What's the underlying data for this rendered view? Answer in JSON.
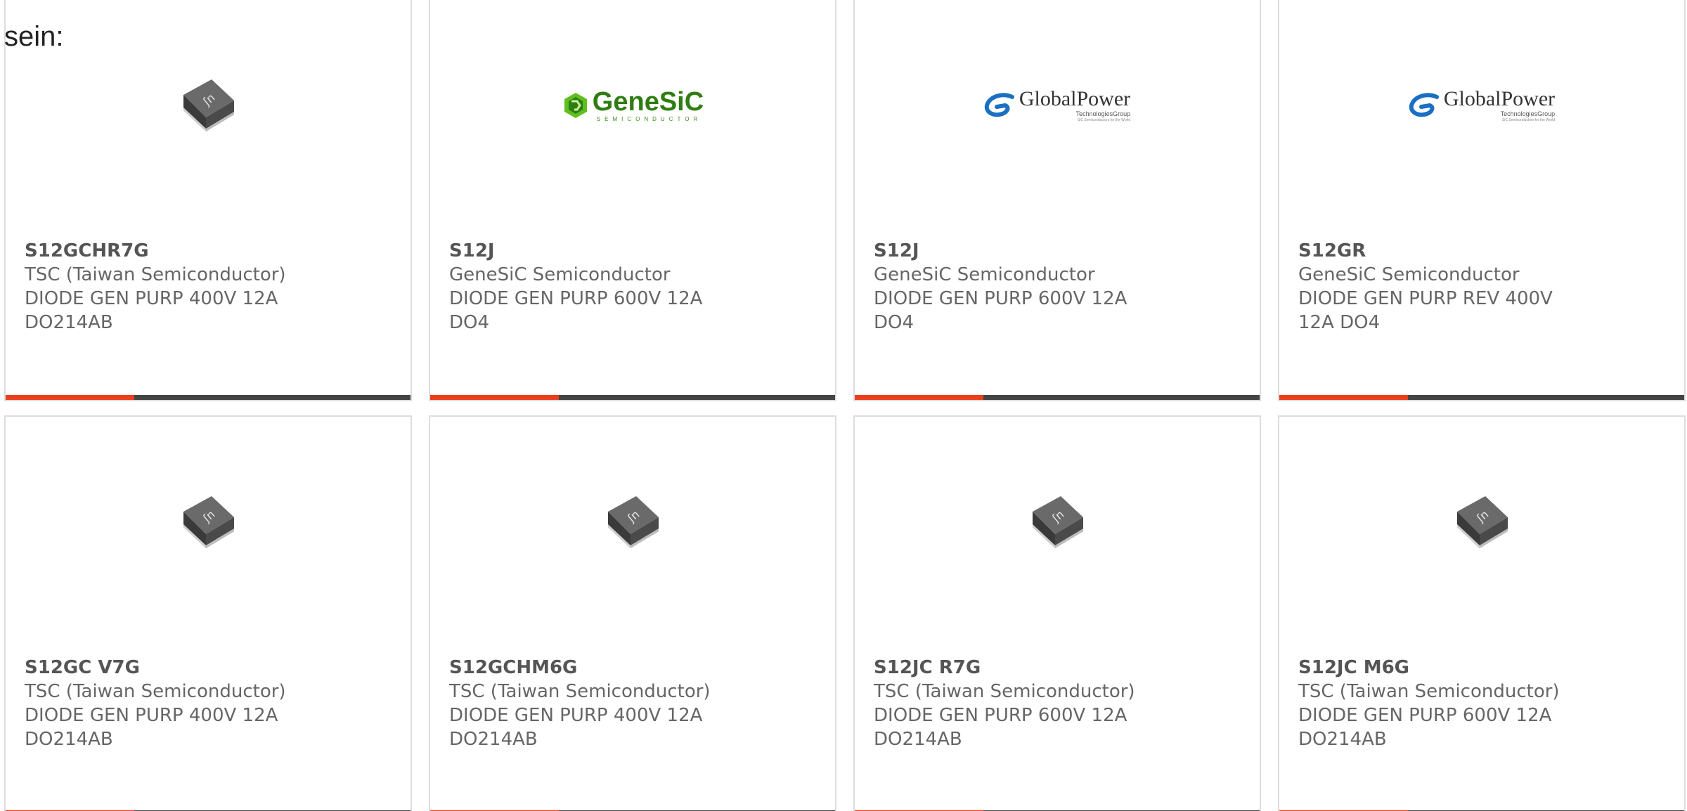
{
  "heading": "sein:",
  "colors": {
    "accent": "#ea3f1c",
    "bar": "#444444",
    "border": "#dddddd",
    "text": "#666666",
    "genesic_green": "#2f7d12",
    "globalpower_blue": "#1a6fc4"
  },
  "logos": {
    "genesic": {
      "name": "GeneSiC",
      "sub": "SEMICONDUCTOR"
    },
    "globalpower": {
      "name": "GlobalPower",
      "sub": "TechnologiesGroup",
      "tag": "SiC Semiconductors for the World"
    }
  },
  "products": [
    {
      "image": "smd-diode-icon",
      "part": "S12GCHR7G",
      "manufacturer": "TSC (Taiwan Semiconductor)",
      "description": "DIODE GEN PURP 400V 12A DO214AB"
    },
    {
      "image": "genesic-logo",
      "part": "S12J",
      "manufacturer": "GeneSiC Semiconductor",
      "description": "DIODE GEN PURP 600V 12A DO4"
    },
    {
      "image": "globalpower-logo",
      "part": "S12J",
      "manufacturer": "GeneSiC Semiconductor",
      "description": "DIODE GEN PURP 600V 12A DO4"
    },
    {
      "image": "globalpower-logo",
      "part": "S12GR",
      "manufacturer": "GeneSiC Semiconductor",
      "description": "DIODE GEN PURP REV 400V 12A DO4"
    },
    {
      "image": "smd-diode-icon",
      "part": "S12GC V7G",
      "manufacturer": "TSC (Taiwan Semiconductor)",
      "description": "DIODE GEN PURP 400V 12A DO214AB"
    },
    {
      "image": "smd-diode-icon",
      "part": "S12GCHM6G",
      "manufacturer": "TSC (Taiwan Semiconductor)",
      "description": "DIODE GEN PURP 400V 12A DO214AB"
    },
    {
      "image": "smd-diode-icon",
      "part": "S12JC R7G",
      "manufacturer": "TSC (Taiwan Semiconductor)",
      "description": "DIODE GEN PURP 600V 12A DO214AB"
    },
    {
      "image": "smd-diode-icon",
      "part": "S12JC M6G",
      "manufacturer": "TSC (Taiwan Semiconductor)",
      "description": "DIODE GEN PURP 600V 12A DO214AB"
    }
  ]
}
